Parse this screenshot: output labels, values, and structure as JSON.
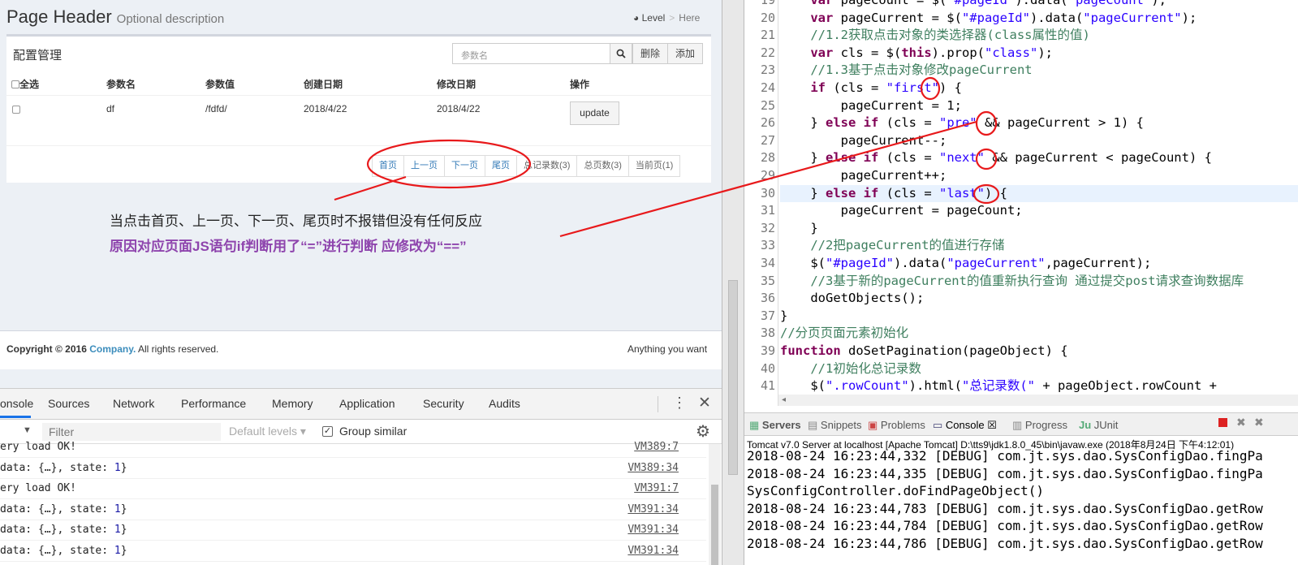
{
  "left": {
    "page_title": "Page Header",
    "page_desc": "Optional description",
    "breadcrumb": {
      "level": "Level",
      "here": "Here"
    },
    "box_title": "配置管理",
    "search_placeholder": "参数名",
    "btn_delete": "删除",
    "btn_add": "添加",
    "table_headers": [
      "全选",
      "参数名",
      "参数值",
      "创建日期",
      "修改日期",
      "操作"
    ],
    "row": {
      "name": "df",
      "value": "/fdfd/",
      "created": "2018/4/22",
      "modified": "2018/4/22",
      "action": "update"
    },
    "pager": [
      "首页",
      "上一页",
      "下一页",
      "尾页",
      "总记录数(3)",
      "总页数(3)",
      "当前页(1)"
    ],
    "note1": "当点击首页、上一页、下一页、尾页时不报错但没有任何反应",
    "note2": "原因对应页面JS语句if判断用了“=”进行判断 应修改为“==”",
    "footer": {
      "copyright": "Copyright © 2016 ",
      "company": "Company.",
      "rights": " All rights reserved.",
      "right": "Anything you want"
    }
  },
  "devtools": {
    "tabs": [
      "onsole",
      "Sources",
      "Network",
      "Performance",
      "Memory",
      "Application",
      "Security",
      "Audits"
    ],
    "filter_placeholder": "Filter",
    "levels": "Default levels ▾",
    "group_similar": "Group similar",
    "rows": [
      {
        "msg": "ery load OK!",
        "src": "VM389:7"
      },
      {
        "msg": "data: {…}, state: 1}",
        "src": "VM389:34"
      },
      {
        "msg": "ery load OK!",
        "src": "VM391:7"
      },
      {
        "msg": "data: {…}, state: 1}",
        "src": "VM391:34"
      },
      {
        "msg": "data: {…}, state: 1}",
        "src": "VM391:34"
      },
      {
        "msg": "data: {…}, state: 1}",
        "src": "VM391:34"
      }
    ]
  },
  "editor": {
    "line_numbers": [
      "19",
      "20",
      "21",
      "22",
      "23",
      "24",
      "25",
      "26",
      "27",
      "28",
      "29",
      "30",
      "31",
      "32",
      "33",
      "34",
      "35",
      "36",
      "37",
      "38",
      "39",
      "40",
      "41"
    ]
  },
  "eclipse": {
    "tabs": [
      "Servers",
      "Snippets",
      "Problems",
      "Console",
      "Progress",
      "JUnit"
    ],
    "server_line": "Tomcat v7.0 Server at localhost [Apache Tomcat] D:\\tts9\\jdk1.8.0_45\\bin\\javaw.exe (2018年8月24日 下午4:12:01)",
    "log_lines": [
      "2018-08-24 16:23:44,332 [DEBUG] com.jt.sys.dao.SysConfigDao.fingPa",
      "2018-08-24 16:23:44,335 [DEBUG] com.jt.sys.dao.SysConfigDao.fingPa",
      "SysConfigController.doFindPageObject()",
      "2018-08-24 16:23:44,783 [DEBUG] com.jt.sys.dao.SysConfigDao.getRow",
      "2018-08-24 16:23:44,784 [DEBUG] com.jt.sys.dao.SysConfigDao.getRow",
      "2018-08-24 16:23:44,786 [DEBUG] com.jt.sys.dao.SysConfigDao.getRow"
    ]
  },
  "colors": {
    "annotation_red": "#e8191b",
    "note_purple": "#8e44ad",
    "link_blue": "#337ab7"
  }
}
